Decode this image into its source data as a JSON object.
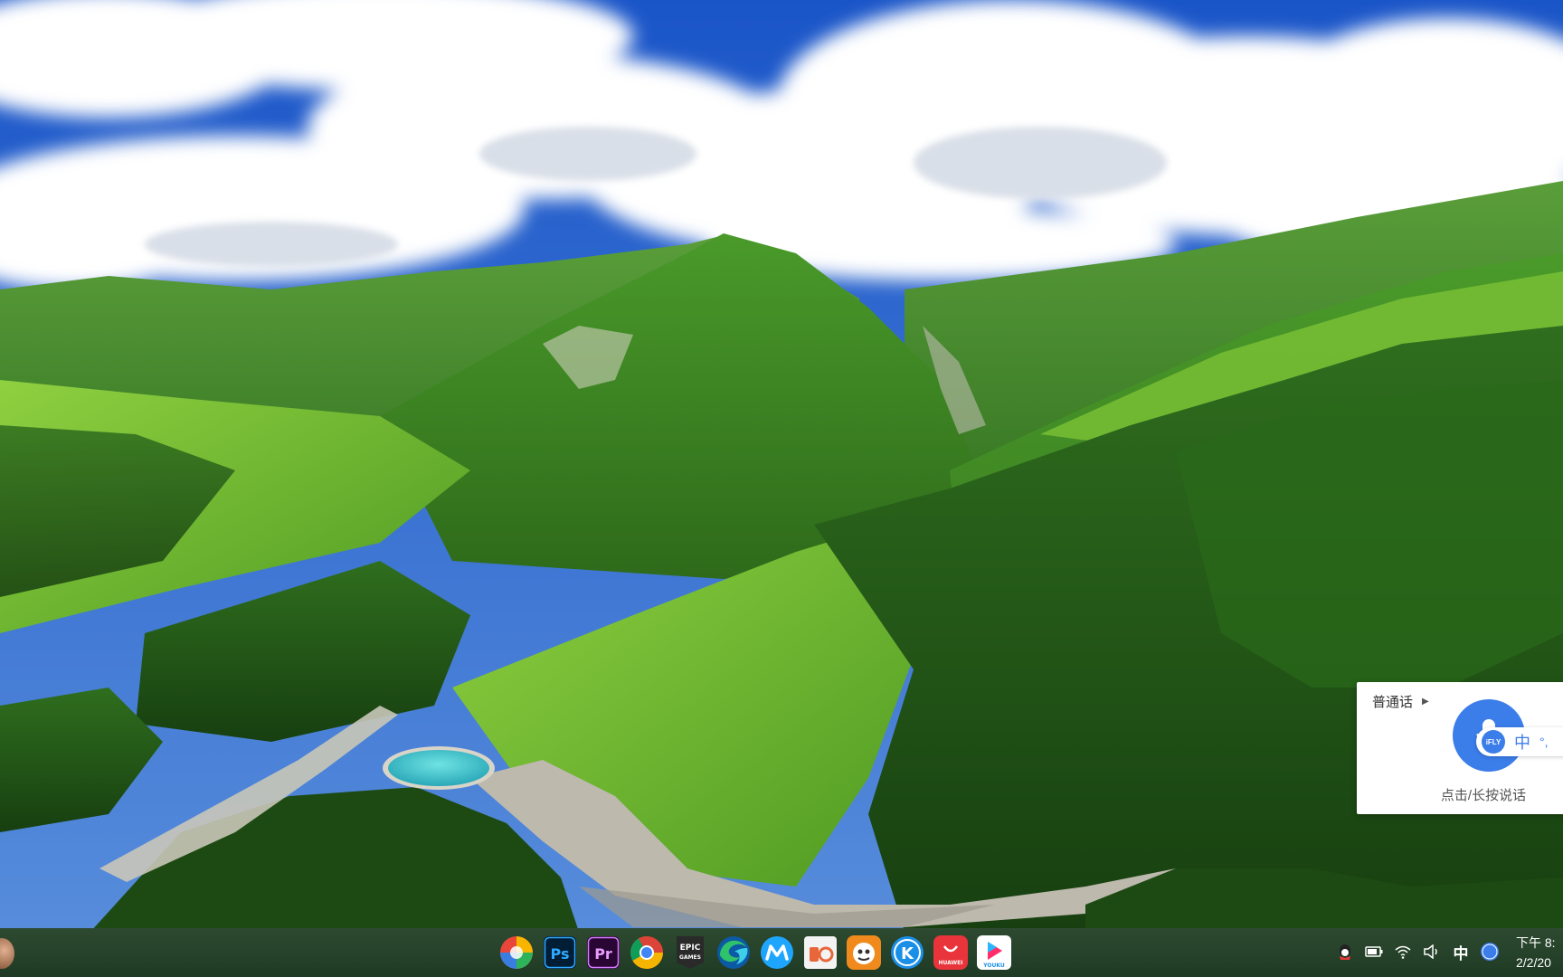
{
  "voice_widget": {
    "language_label": "普通话",
    "ime_mode": "中",
    "ime_punct": "°,",
    "brand": "iFLY",
    "hint": "点击/长按说话"
  },
  "taskbar": {
    "apps": [
      {
        "id": "photos",
        "label": ""
      },
      {
        "id": "photoshop",
        "label": "Ps"
      },
      {
        "id": "premiere",
        "label": "Pr"
      },
      {
        "id": "chrome",
        "label": ""
      },
      {
        "id": "epic-games",
        "label": "EPIC GAMES"
      },
      {
        "id": "edge",
        "label": ""
      },
      {
        "id": "meitu",
        "label": ""
      },
      {
        "id": "office",
        "label": ""
      },
      {
        "id": "tianyi",
        "label": ""
      },
      {
        "id": "kugou",
        "label": "K"
      },
      {
        "id": "huawei-appgallery",
        "label": "HUAWEI"
      },
      {
        "id": "youku",
        "label": "YOUKU"
      }
    ],
    "tray": {
      "ime": "中",
      "ifly": "iFLY"
    },
    "clock": {
      "time": "下午 8:",
      "date": "2/2/20"
    }
  },
  "colors": {
    "ifly_blue": "#3b7de9",
    "taskbar": "#26422a"
  }
}
